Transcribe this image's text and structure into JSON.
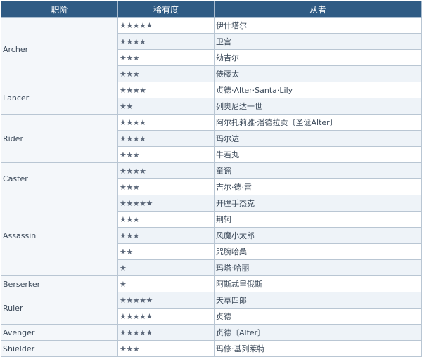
{
  "headers": [
    "职阶",
    "稀有度",
    "从者"
  ],
  "groups": [
    {
      "class": "Archer",
      "rows": [
        {
          "stars": "★★★★★",
          "name": "伊什塔尔"
        },
        {
          "stars": "★★★★",
          "name": "卫宫"
        },
        {
          "stars": "★★★",
          "name": "幼吉尔"
        },
        {
          "stars": "★★★",
          "name": "俵藤太"
        }
      ]
    },
    {
      "class": "Lancer",
      "rows": [
        {
          "stars": "★★★★",
          "name": "贞德·Alter·Santa·Lily"
        },
        {
          "stars": "★★",
          "name": "列奥尼达一世"
        }
      ]
    },
    {
      "class": "Rider",
      "rows": [
        {
          "stars": "★★★★",
          "name": "阿尔托莉雅·潘德拉贡〔圣诞Alter〕"
        },
        {
          "stars": "★★★★",
          "name": "玛尔达"
        },
        {
          "stars": "★★★",
          "name": "牛若丸"
        }
      ]
    },
    {
      "class": "Caster",
      "rows": [
        {
          "stars": "★★★★",
          "name": "童谣"
        },
        {
          "stars": "★★★",
          "name": "吉尔·德·雷"
        }
      ]
    },
    {
      "class": "Assassin",
      "rows": [
        {
          "stars": "★★★★★",
          "name": "开膛手杰克"
        },
        {
          "stars": "★★★",
          "name": "荆轲"
        },
        {
          "stars": "★★★",
          "name": "风魔小太郎"
        },
        {
          "stars": "★★",
          "name": "咒腕哈桑"
        },
        {
          "stars": "★",
          "name": "玛塔·哈丽"
        }
      ]
    },
    {
      "class": "Berserker",
      "rows": [
        {
          "stars": "★",
          "name": "阿斯忒里俄斯"
        }
      ]
    },
    {
      "class": "Ruler",
      "rows": [
        {
          "stars": "★★★★★",
          "name": "天草四郎"
        },
        {
          "stars": "★★★★★",
          "name": "贞德"
        }
      ]
    },
    {
      "class": "Avenger",
      "rows": [
        {
          "stars": "★★★★★",
          "name": "贞德〔Alter〕"
        }
      ]
    },
    {
      "class": "Shielder",
      "rows": [
        {
          "stars": "★★★",
          "name": "玛修·基列莱特"
        }
      ]
    }
  ]
}
